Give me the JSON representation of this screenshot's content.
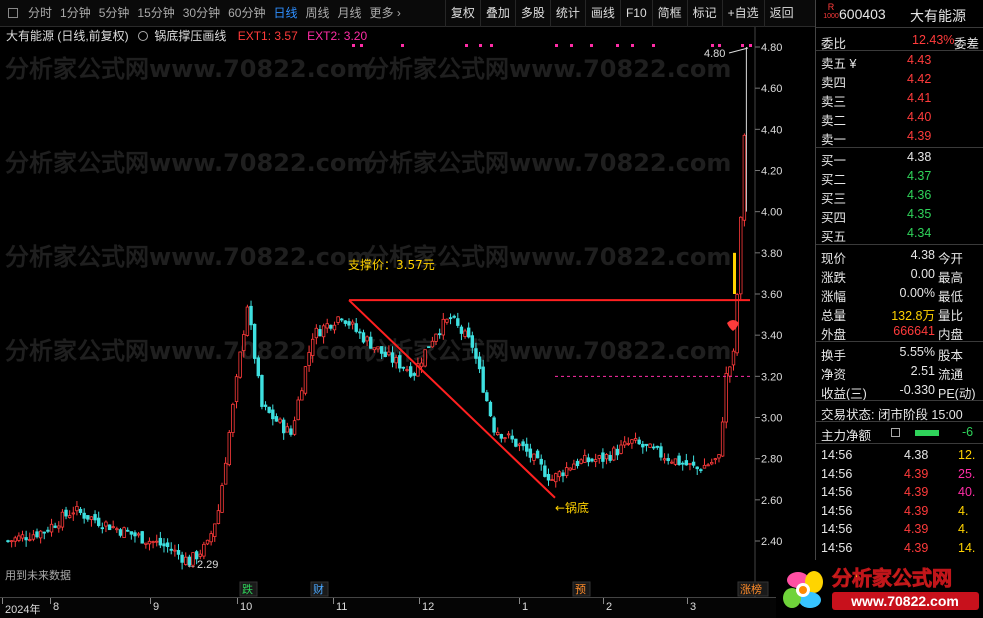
{
  "toolbar": {
    "periods": [
      "分时",
      "1分钟",
      "5分钟",
      "15分钟",
      "30分钟",
      "60分钟",
      "日线",
      "周线",
      "月线",
      "更多 ›"
    ],
    "active_period": "日线",
    "tools": [
      "复权",
      "叠加",
      "多股",
      "统计",
      "画线",
      "F10",
      "简框",
      "标记",
      "+自选",
      "返回"
    ]
  },
  "chart": {
    "stock_label": "大有能源 (日线,前复权)",
    "indicator_name": "锅底撑压画线",
    "ext1": "EXT1: 3.57",
    "ext2": "EXT2: 3.20",
    "support_text": "支撑价：3.57元",
    "bottom_text": "←锅底",
    "low_text": "←2.29",
    "high_text": "4.80",
    "future_data_text": "用到未来数据",
    "watermark": "分析家公式网www.70822.com",
    "event_tags": [
      {
        "text": "跌",
        "color": "#2fd35a"
      },
      {
        "text": "财",
        "color": "#4aa8ff"
      },
      {
        "text": "预",
        "color": "#ff8c2a"
      },
      {
        "text": "涨榜",
        "color": "#ff8c2a"
      }
    ],
    "y_ticks": [
      "4.80",
      "4.60",
      "4.40",
      "4.20",
      "4.00",
      "3.80",
      "3.60",
      "3.40",
      "3.20",
      "3.00",
      "2.80",
      "2.60",
      "2.40"
    ],
    "x_ticks": [
      "2024年",
      "8",
      "9",
      "10",
      "11",
      "12",
      "1",
      "2",
      "3"
    ]
  },
  "panel": {
    "badge_r": "R",
    "badge_num": "1000",
    "code": "600403",
    "name": "大有能源",
    "weibi_label": "委比",
    "weibi_value": "12.43%",
    "weicha_label": "委差",
    "asks": [
      {
        "label": "卖五 ¥",
        "price": "4.43"
      },
      {
        "label": "卖四",
        "price": "4.42"
      },
      {
        "label": "卖三",
        "price": "4.41"
      },
      {
        "label": "卖二",
        "price": "4.40"
      },
      {
        "label": "卖一",
        "price": "4.39"
      }
    ],
    "bids": [
      {
        "label": "买一",
        "price": "4.38"
      },
      {
        "label": "买二",
        "price": "4.37"
      },
      {
        "label": "买三",
        "price": "4.36"
      },
      {
        "label": "买四",
        "price": "4.35"
      },
      {
        "label": "买五",
        "price": "4.34"
      }
    ],
    "quote": [
      {
        "l": "现价",
        "v": "4.38",
        "r": "今开",
        "vc": "white"
      },
      {
        "l": "涨跌",
        "v": "0.00",
        "r": "最高",
        "vc": "white"
      },
      {
        "l": "涨幅",
        "v": "0.00%",
        "r": "最低",
        "vc": "white"
      },
      {
        "l": "总量",
        "v": "132.8万",
        "r": "量比",
        "vc": "yellow"
      },
      {
        "l": "外盘",
        "v": "666641",
        "r": "内盘",
        "vc": "red"
      }
    ],
    "quote2": [
      {
        "l": "换手",
        "v": "5.55%",
        "r": "股本"
      },
      {
        "l": "净资",
        "v": "2.51",
        "r": "流通"
      },
      {
        "l": "收益(三)",
        "v": "-0.330",
        "r": "PE(动)"
      }
    ],
    "status": "交易状态: 闭市阶段 15:00",
    "main_flow_label": "主力净额",
    "main_flow_value": "-6",
    "ticks": [
      {
        "t": "14:56",
        "p": "4.38",
        "pc": "white",
        "v": "12.",
        "vc": "yellow"
      },
      {
        "t": "14:56",
        "p": "4.39",
        "pc": "red",
        "v": "25.",
        "vc": "magenta"
      },
      {
        "t": "14:56",
        "p": "4.39",
        "pc": "red",
        "v": "40.",
        "vc": "magenta"
      },
      {
        "t": "14:56",
        "p": "4.39",
        "pc": "red",
        "v": "4.",
        "vc": "yellow"
      },
      {
        "t": "14:56",
        "p": "4.39",
        "pc": "red",
        "v": "4.",
        "vc": "yellow"
      },
      {
        "t": "14:56",
        "p": "4.39",
        "pc": "red",
        "v": "14.",
        "vc": "yellow"
      }
    ]
  },
  "logo": {
    "title": "分析家公式网",
    "url": "www.70822.com"
  }
}
